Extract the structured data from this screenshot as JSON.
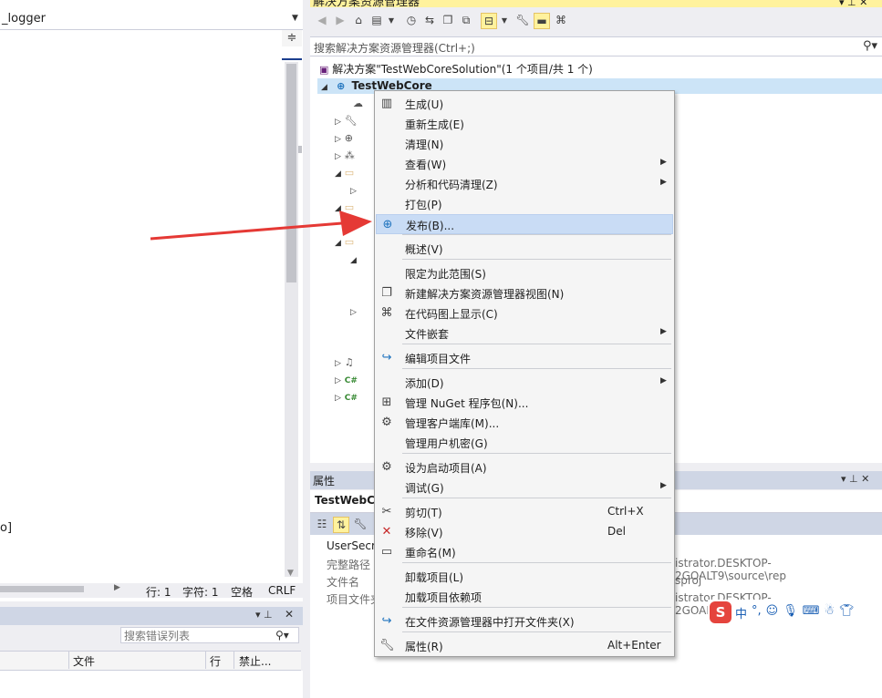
{
  "editor": {
    "tab_text": "_logger",
    "split_glyph": "≑",
    "partial_text": "o]",
    "status": {
      "line": "行: 1",
      "char": "字符: 1",
      "space": "空格",
      "crlf": "CRLF"
    }
  },
  "error_list": {
    "search_placeholder": "搜索错误列表",
    "columns": [
      "文件",
      "行",
      "禁止..."
    ]
  },
  "solution_explorer": {
    "title": "解决方案资源管理器",
    "search_placeholder": "搜索解决方案资源管理器(Ctrl+;)",
    "solution_label": "解决方案\"TestWebCoreSolution\"(1 个项目/共 1 个)",
    "project_label": "TestWebCore"
  },
  "properties": {
    "title": "属性",
    "object": "TestWebC",
    "rows": [
      {
        "name": "UserSecr",
        "value": ""
      },
      {
        "name": "完整路径",
        "value": "istrator.DESKTOP-2GOALT9\\source\\rep"
      },
      {
        "name": "文件名",
        "value": "sproj"
      },
      {
        "name": "项目文件夹",
        "value": "istrator.DESKTOP-2GOALT9\\source\\rep"
      }
    ]
  },
  "ime": {
    "logo": "S",
    "lang": "中"
  },
  "context_menu": {
    "items": [
      {
        "label": "生成(U)",
        "icon": "build-icon"
      },
      {
        "label": "重新生成(E)"
      },
      {
        "label": "清理(N)"
      },
      {
        "label": "查看(W)",
        "submenu": true
      },
      {
        "label": "分析和代码清理(Z)",
        "submenu": true
      },
      {
        "label": "打包(P)"
      },
      {
        "label": "发布(B)...",
        "icon": "publish-icon",
        "highlighted": true
      },
      {
        "label": "概述(V)"
      },
      {
        "label": "限定为此范围(S)"
      },
      {
        "label": "新建解决方案资源管理器视图(N)",
        "icon": "new-view-icon"
      },
      {
        "label": "在代码图上显示(C)",
        "icon": "code-map-icon"
      },
      {
        "label": "文件嵌套",
        "submenu": true
      },
      {
        "label": "编辑项目文件",
        "icon": "edit-project-icon"
      },
      {
        "label": "添加(D)",
        "submenu": true
      },
      {
        "label": "管理 NuGet 程序包(N)...",
        "icon": "nuget-icon"
      },
      {
        "label": "管理客户端库(M)...",
        "icon": "client-lib-icon"
      },
      {
        "label": "管理用户机密(G)"
      },
      {
        "label": "设为启动项目(A)",
        "icon": "gear-icon"
      },
      {
        "label": "调试(G)",
        "submenu": true
      },
      {
        "label": "剪切(T)",
        "icon": "scissors-icon",
        "shortcut": "Ctrl+X"
      },
      {
        "label": "移除(V)",
        "icon": "remove-icon",
        "shortcut": "Del"
      },
      {
        "label": "重命名(M)",
        "icon": "rename-icon"
      },
      {
        "label": "卸载项目(L)"
      },
      {
        "label": "加载项目依赖项"
      },
      {
        "label": "在文件资源管理器中打开文件夹(X)",
        "icon": "open-folder-icon"
      },
      {
        "label": "属性(R)",
        "icon": "wrench-icon",
        "shortcut": "Alt+Enter"
      }
    ]
  },
  "colors": {
    "menu_highlight": "#c9dcf5",
    "tree_selection": "#cce4f7",
    "arrow": "#e53935",
    "title_active": "#fff29d"
  }
}
